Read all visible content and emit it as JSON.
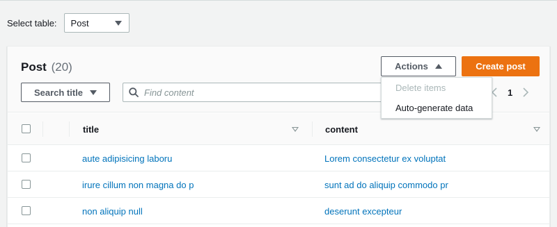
{
  "select_table": {
    "label": "Select table:",
    "value": "Post"
  },
  "panel": {
    "title": "Post",
    "count": "(20)",
    "actions_label": "Actions",
    "create_label": "Create post",
    "search_attr_label": "Search title",
    "find_placeholder": "Find content",
    "current_page": "1"
  },
  "actions_menu": [
    {
      "label": "Delete items",
      "disabled": true
    },
    {
      "label": "Auto-generate data",
      "disabled": false
    }
  ],
  "table": {
    "columns": [
      "title",
      "content"
    ],
    "rows": [
      {
        "title": "aute adipisicing laboru",
        "content": "Lorem consectetur ex voluptat"
      },
      {
        "title": "irure cillum non magna do p",
        "content": "sunt ad do aliquip commodo pr"
      },
      {
        "title": "non aliquip null",
        "content": "deserunt excepteur"
      }
    ]
  },
  "colors": {
    "primary": "#ec7211",
    "link": "#0073bb",
    "text": "#16191f",
    "muted": "#879596"
  },
  "icons": {
    "search": "search-icon",
    "caret_down": "caret-down-icon",
    "caret_up": "caret-up-icon",
    "prev": "chevron-left-icon",
    "next": "chevron-right-icon"
  }
}
